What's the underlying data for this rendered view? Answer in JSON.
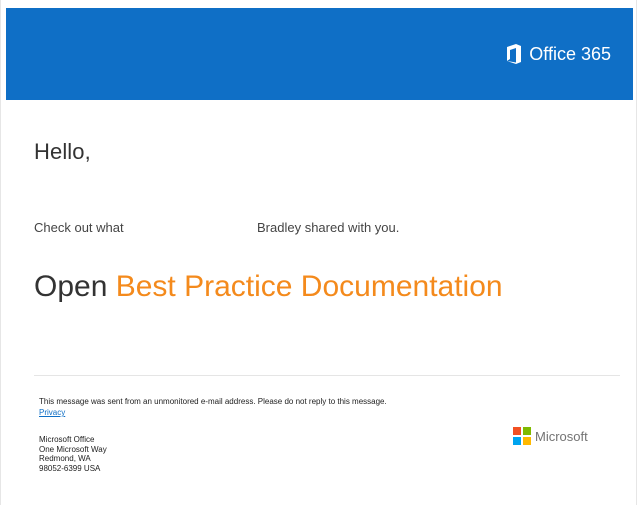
{
  "header": {
    "brand": "Office 365",
    "icon": "office-logo-icon",
    "background_color": "#0f6fc6",
    "text_color": "#ffffff"
  },
  "message": {
    "greeting": "Hello,",
    "share_prefix": "Check out what",
    "share_suffix": "Bradley shared with you.",
    "open_label": "Open",
    "document_title": "Best Practice Documentation",
    "link_color": "#f48a1c"
  },
  "footer": {
    "notice": "This message was sent from an unmonitored e-mail address. Please do not reply to this message.",
    "privacy_label": "Privacy",
    "address": [
      "Microsoft Office",
      "One Microsoft Way",
      "Redmond, WA",
      "98052-6399 USA"
    ],
    "microsoft_brand": "Microsoft",
    "microsoft_logo_colors": [
      "#f25022",
      "#7fba00",
      "#00a4ef",
      "#ffb900"
    ]
  }
}
